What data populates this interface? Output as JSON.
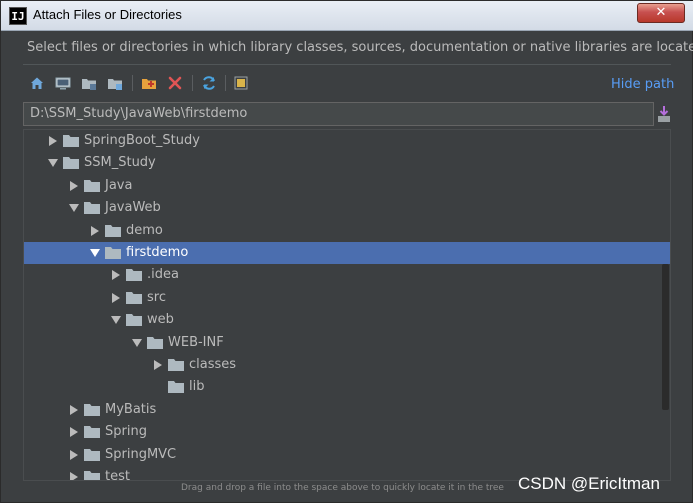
{
  "window": {
    "title": "Attach Files or Directories",
    "app_icon_text": "IJ",
    "close_glyph": "✕"
  },
  "description": "Select files or directories in which library classes, sources, documentation or native libraries are located",
  "toolbar": {
    "buttons": [
      "home-icon",
      "desktop-icon",
      "project-icon",
      "module-icon",
      "new-folder-icon",
      "delete-icon",
      "refresh-icon",
      "show-hidden-icon"
    ],
    "hide_path_label": "Hide path"
  },
  "path": {
    "value": "D:\\SSM_Study\\JavaWeb\\firstdemo"
  },
  "tree": {
    "items": [
      {
        "label": "SpringBoot_Study",
        "depth": 1,
        "expanded": false,
        "has_children": true,
        "selected": false
      },
      {
        "label": "SSM_Study",
        "depth": 1,
        "expanded": true,
        "has_children": true,
        "selected": false
      },
      {
        "label": "Java",
        "depth": 2,
        "expanded": false,
        "has_children": true,
        "selected": false
      },
      {
        "label": "JavaWeb",
        "depth": 2,
        "expanded": true,
        "has_children": true,
        "selected": false
      },
      {
        "label": "demo",
        "depth": 3,
        "expanded": false,
        "has_children": true,
        "selected": false
      },
      {
        "label": "firstdemo",
        "depth": 3,
        "expanded": true,
        "has_children": true,
        "selected": true
      },
      {
        "label": ".idea",
        "depth": 4,
        "expanded": false,
        "has_children": true,
        "selected": false
      },
      {
        "label": "src",
        "depth": 4,
        "expanded": false,
        "has_children": true,
        "selected": false
      },
      {
        "label": "web",
        "depth": 4,
        "expanded": true,
        "has_children": true,
        "selected": false
      },
      {
        "label": "WEB-INF",
        "depth": 5,
        "expanded": true,
        "has_children": true,
        "selected": false
      },
      {
        "label": "classes",
        "depth": 6,
        "expanded": false,
        "has_children": true,
        "selected": false
      },
      {
        "label": "lib",
        "depth": 6,
        "expanded": false,
        "has_children": false,
        "selected": false
      },
      {
        "label": "MyBatis",
        "depth": 2,
        "expanded": false,
        "has_children": true,
        "selected": false
      },
      {
        "label": "Spring",
        "depth": 2,
        "expanded": false,
        "has_children": true,
        "selected": false
      },
      {
        "label": "SpringMVC",
        "depth": 2,
        "expanded": false,
        "has_children": true,
        "selected": false
      },
      {
        "label": "test",
        "depth": 2,
        "expanded": false,
        "has_children": true,
        "selected": false
      }
    ]
  },
  "hint": "Drag and drop a file into the space above to quickly locate it in the tree",
  "watermark": "CSDN @EricItman",
  "colors": {
    "background": "#3c3f41",
    "selection": "#4b6eaf",
    "link": "#589df6",
    "folder": "#aeb9c0"
  }
}
